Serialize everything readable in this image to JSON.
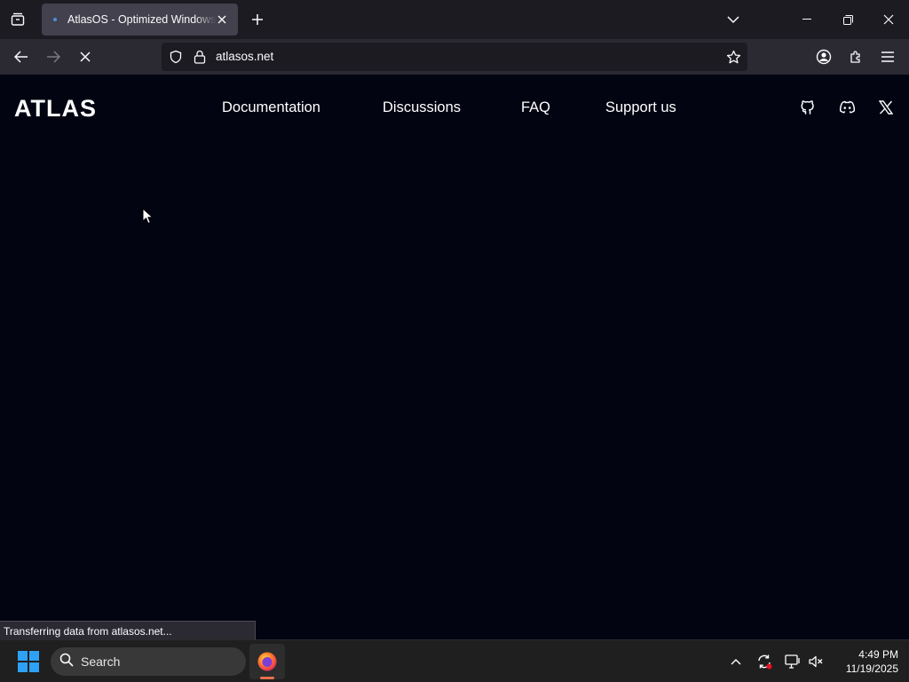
{
  "browser": {
    "tab": {
      "title": "AtlasOS - Optimized Windows, Enhanced",
      "dot_color": "#4a90e2"
    },
    "url": "atlasos.net",
    "status_text": "Transferring data from atlasos.net..."
  },
  "site": {
    "logo_text": "ATLAS",
    "nav": [
      "Documentation",
      "Discussions",
      "FAQ",
      "Support us"
    ],
    "social_icons": [
      "github-icon",
      "discord-icon",
      "x-icon"
    ],
    "background": "#020412"
  },
  "taskbar": {
    "search_label": "Search",
    "time": "4:49 PM",
    "date": "11/19/2025",
    "pinned_app": "firefox"
  }
}
